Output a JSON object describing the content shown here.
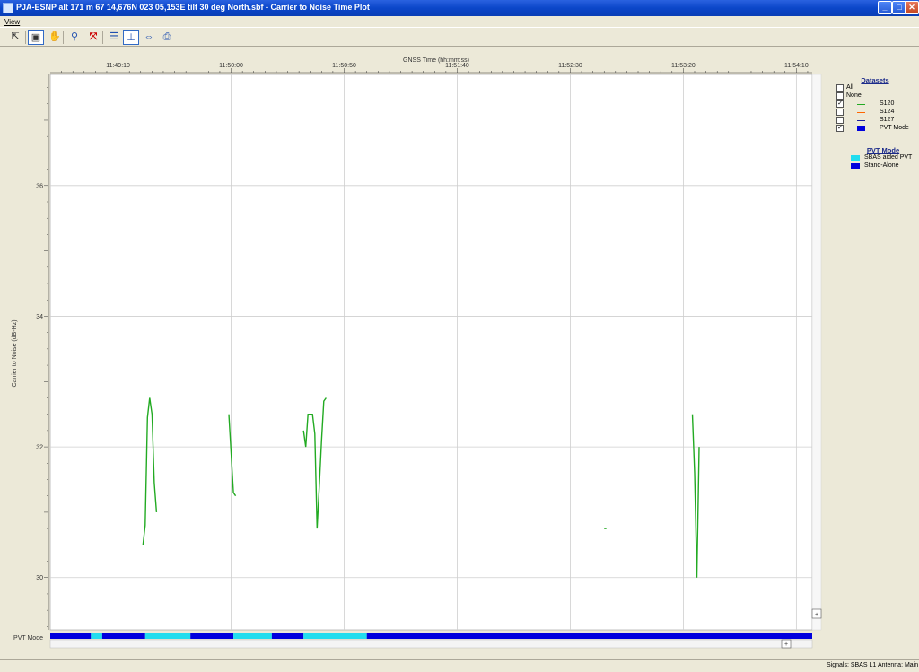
{
  "window": {
    "title": "PJA-ESNP alt 171 m 67 14,676N 023 05,153E tilt 30 deg North.sbf - Carrier to Noise Time Plot",
    "min_glyph": "_",
    "max_glyph": "□",
    "close_glyph": "✕"
  },
  "menu": {
    "view": "View"
  },
  "toolbar": {
    "icons": [
      "pointer-icon",
      "select-box-icon",
      "pan-hand-icon",
      "zoom-icon",
      "fit-all-icon",
      "vertical-fit-icon",
      "horizontal-fit-icon",
      "zoom-out-icon",
      "print-icon"
    ]
  },
  "chart_data": {
    "type": "line",
    "title": "",
    "xlabel": "GNSS Time (hh:mm:ss)",
    "ylabel": "Carrier to Noise (dB-Hz)",
    "x_ticks": [
      "11:49:10",
      "11:50:00",
      "11:50:50",
      "11:51:40",
      "11:52:30",
      "11:53:20",
      "11:54:10"
    ],
    "x_tick_seconds": [
      42550,
      42600,
      42650,
      42700,
      42750,
      42800,
      42850
    ],
    "xlim": [
      42520,
      42857
    ],
    "y_ticks": [
      30,
      32,
      34,
      36
    ],
    "ylim": [
      29.2,
      37.7
    ],
    "grid": true,
    "series": [
      {
        "name": "S120",
        "color": "#22aa22",
        "segments": [
          [
            [
              42561,
              30.5
            ],
            [
              42562,
              30.8
            ],
            [
              42563,
              32.45
            ],
            [
              42564,
              32.75
            ],
            [
              42565,
              32.5
            ],
            [
              42566,
              31.45
            ],
            [
              42567,
              31.0
            ]
          ],
          [
            [
              42599,
              32.5
            ],
            [
              42601,
              31.3
            ],
            [
              42602,
              31.25
            ]
          ],
          [
            [
              42632,
              32.25
            ],
            [
              42633,
              32.0
            ],
            [
              42634,
              32.5
            ],
            [
              42635,
              32.5
            ],
            [
              42636,
              32.5
            ],
            [
              42637,
              32.2
            ],
            [
              42638,
              30.75
            ],
            [
              42639,
              31.4
            ],
            [
              42640,
              32.1
            ],
            [
              42641,
              32.7
            ],
            [
              42642,
              32.75
            ]
          ],
          [
            [
              42765,
              30.75
            ],
            [
              42766,
              30.75
            ]
          ],
          [
            [
              42804,
              32.5
            ],
            [
              42805,
              31.6
            ],
            [
              42806,
              30.0
            ],
            [
              42807,
              32.0
            ]
          ]
        ]
      },
      {
        "name": "S124",
        "color": "#ff6600",
        "segments": []
      },
      {
        "name": "S127",
        "color": "#1a1aa0",
        "segments": []
      }
    ],
    "pvt_mode_track": {
      "label": "PVT Mode",
      "segments": [
        {
          "from": 42520,
          "to": 42538,
          "mode": "Stand-Alone"
        },
        {
          "from": 42538,
          "to": 42543,
          "mode": "SBAS aided PVT"
        },
        {
          "from": 42543,
          "to": 42562,
          "mode": "Stand-Alone"
        },
        {
          "from": 42562,
          "to": 42582,
          "mode": "SBAS aided PVT"
        },
        {
          "from": 42582,
          "to": 42601,
          "mode": "Stand-Alone"
        },
        {
          "from": 42601,
          "to": 42618,
          "mode": "SBAS aided PVT"
        },
        {
          "from": 42618,
          "to": 42632,
          "mode": "Stand-Alone"
        },
        {
          "from": 42632,
          "to": 42660,
          "mode": "SBAS aided PVT"
        },
        {
          "from": 42660,
          "to": 42857,
          "mode": "Stand-Alone"
        }
      ]
    }
  },
  "legend": {
    "datasets_title": "Datasets",
    "all_label": "All",
    "none_label": "None",
    "items": [
      {
        "label": "S120",
        "checked": true,
        "check_glyph": "✓",
        "color": "#22aa22",
        "kind": "line"
      },
      {
        "label": "S124",
        "checked": false,
        "check_glyph": "",
        "color": "#ff6600",
        "kind": "line"
      },
      {
        "label": "S127",
        "checked": false,
        "check_glyph": "",
        "color": "#1a1aa0",
        "kind": "line"
      },
      {
        "label": "PVT Mode",
        "checked": true,
        "check_glyph": "✓",
        "color": "#0000dd",
        "kind": "box"
      }
    ],
    "pvt_title": "PVT Mode",
    "pvt_items": [
      {
        "label": "SBAS aided PVT",
        "color": "#22ddee"
      },
      {
        "label": "Stand-Alone",
        "color": "#0000dd"
      }
    ]
  },
  "status": {
    "signals": "Signals: SBAS L1",
    "antenna": "Antenna: Main"
  },
  "scroll": {
    "plus_glyph": "+"
  }
}
